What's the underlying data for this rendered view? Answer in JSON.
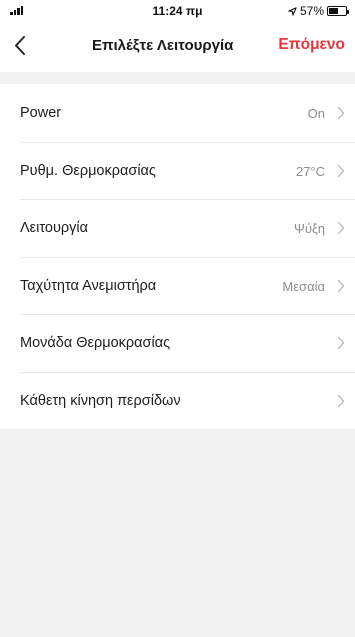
{
  "status_bar": {
    "time": "11:24 πμ",
    "battery_text": "57%",
    "battery_level": 0.57,
    "icons": [
      "signal-icon",
      "location-arrow-icon",
      "battery-icon"
    ]
  },
  "nav": {
    "back_icon": "chevron-left-icon",
    "title": "Επιλέξτε Λειτουργία",
    "next_label": "Επόμενο",
    "accent_color": "#e8343c"
  },
  "settings": [
    {
      "label": "Power",
      "value": "On"
    },
    {
      "label": "Ρυθμ. Θερμοκρασίας",
      "value": "27°C"
    },
    {
      "label": "Λειτουργία",
      "value": "Ψύξη"
    },
    {
      "label": "Ταχύτητα Ανεμιστήρα",
      "value": "Μεσαία"
    },
    {
      "label": "Μονάδα Θερμοκρασίας",
      "value": ""
    },
    {
      "label": "Κάθετη κίνηση περσίδων",
      "value": ""
    }
  ]
}
